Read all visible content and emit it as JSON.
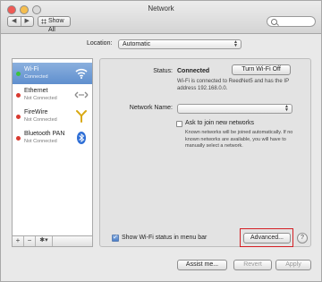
{
  "window": {
    "title": "Network"
  },
  "toolbar": {
    "back": "◀",
    "forward": "▶",
    "show_all": "Show All"
  },
  "location": {
    "label": "Location:",
    "value": "Automatic"
  },
  "services": [
    {
      "name": "Wi-Fi",
      "status": "Connected",
      "dot_color": "#3cc23c",
      "icon": "wifi-icon"
    },
    {
      "name": "Ethernet",
      "status": "Not Connected",
      "dot_color": "#d83a30",
      "icon": "ethernet-icon"
    },
    {
      "name": "FireWire",
      "status": "Not Connected",
      "dot_color": "#d83a30",
      "icon": "firewire-icon"
    },
    {
      "name": "Bluetooth PAN",
      "status": "Not Connected",
      "dot_color": "#d83a30",
      "icon": "bluetooth-icon"
    }
  ],
  "sidebar_tools": {
    "add": "+",
    "remove": "−",
    "gear": "✱▾"
  },
  "detail": {
    "status_label": "Status:",
    "status_value": "Connected",
    "turn_off_button": "Turn Wi-Fi Off",
    "status_desc": "Wi-Fi is connected to ReedNet5 and has the IP address 192.168.0.0.",
    "network_name_label": "Network Name:",
    "network_name_value": "",
    "ask_label": "Ask to join new networks",
    "ask_desc": "Known networks will be joined automatically. If no known networks are available, you will have to manually select a network.",
    "show_status_label": "Show Wi-Fi status in menu bar",
    "advanced_button": "Advanced...",
    "help": "?"
  },
  "footer": {
    "assist": "Assist me...",
    "revert": "Revert",
    "apply": "Apply"
  },
  "colors": {
    "highlight": "#d41f24",
    "selection": "#5f8fce"
  }
}
